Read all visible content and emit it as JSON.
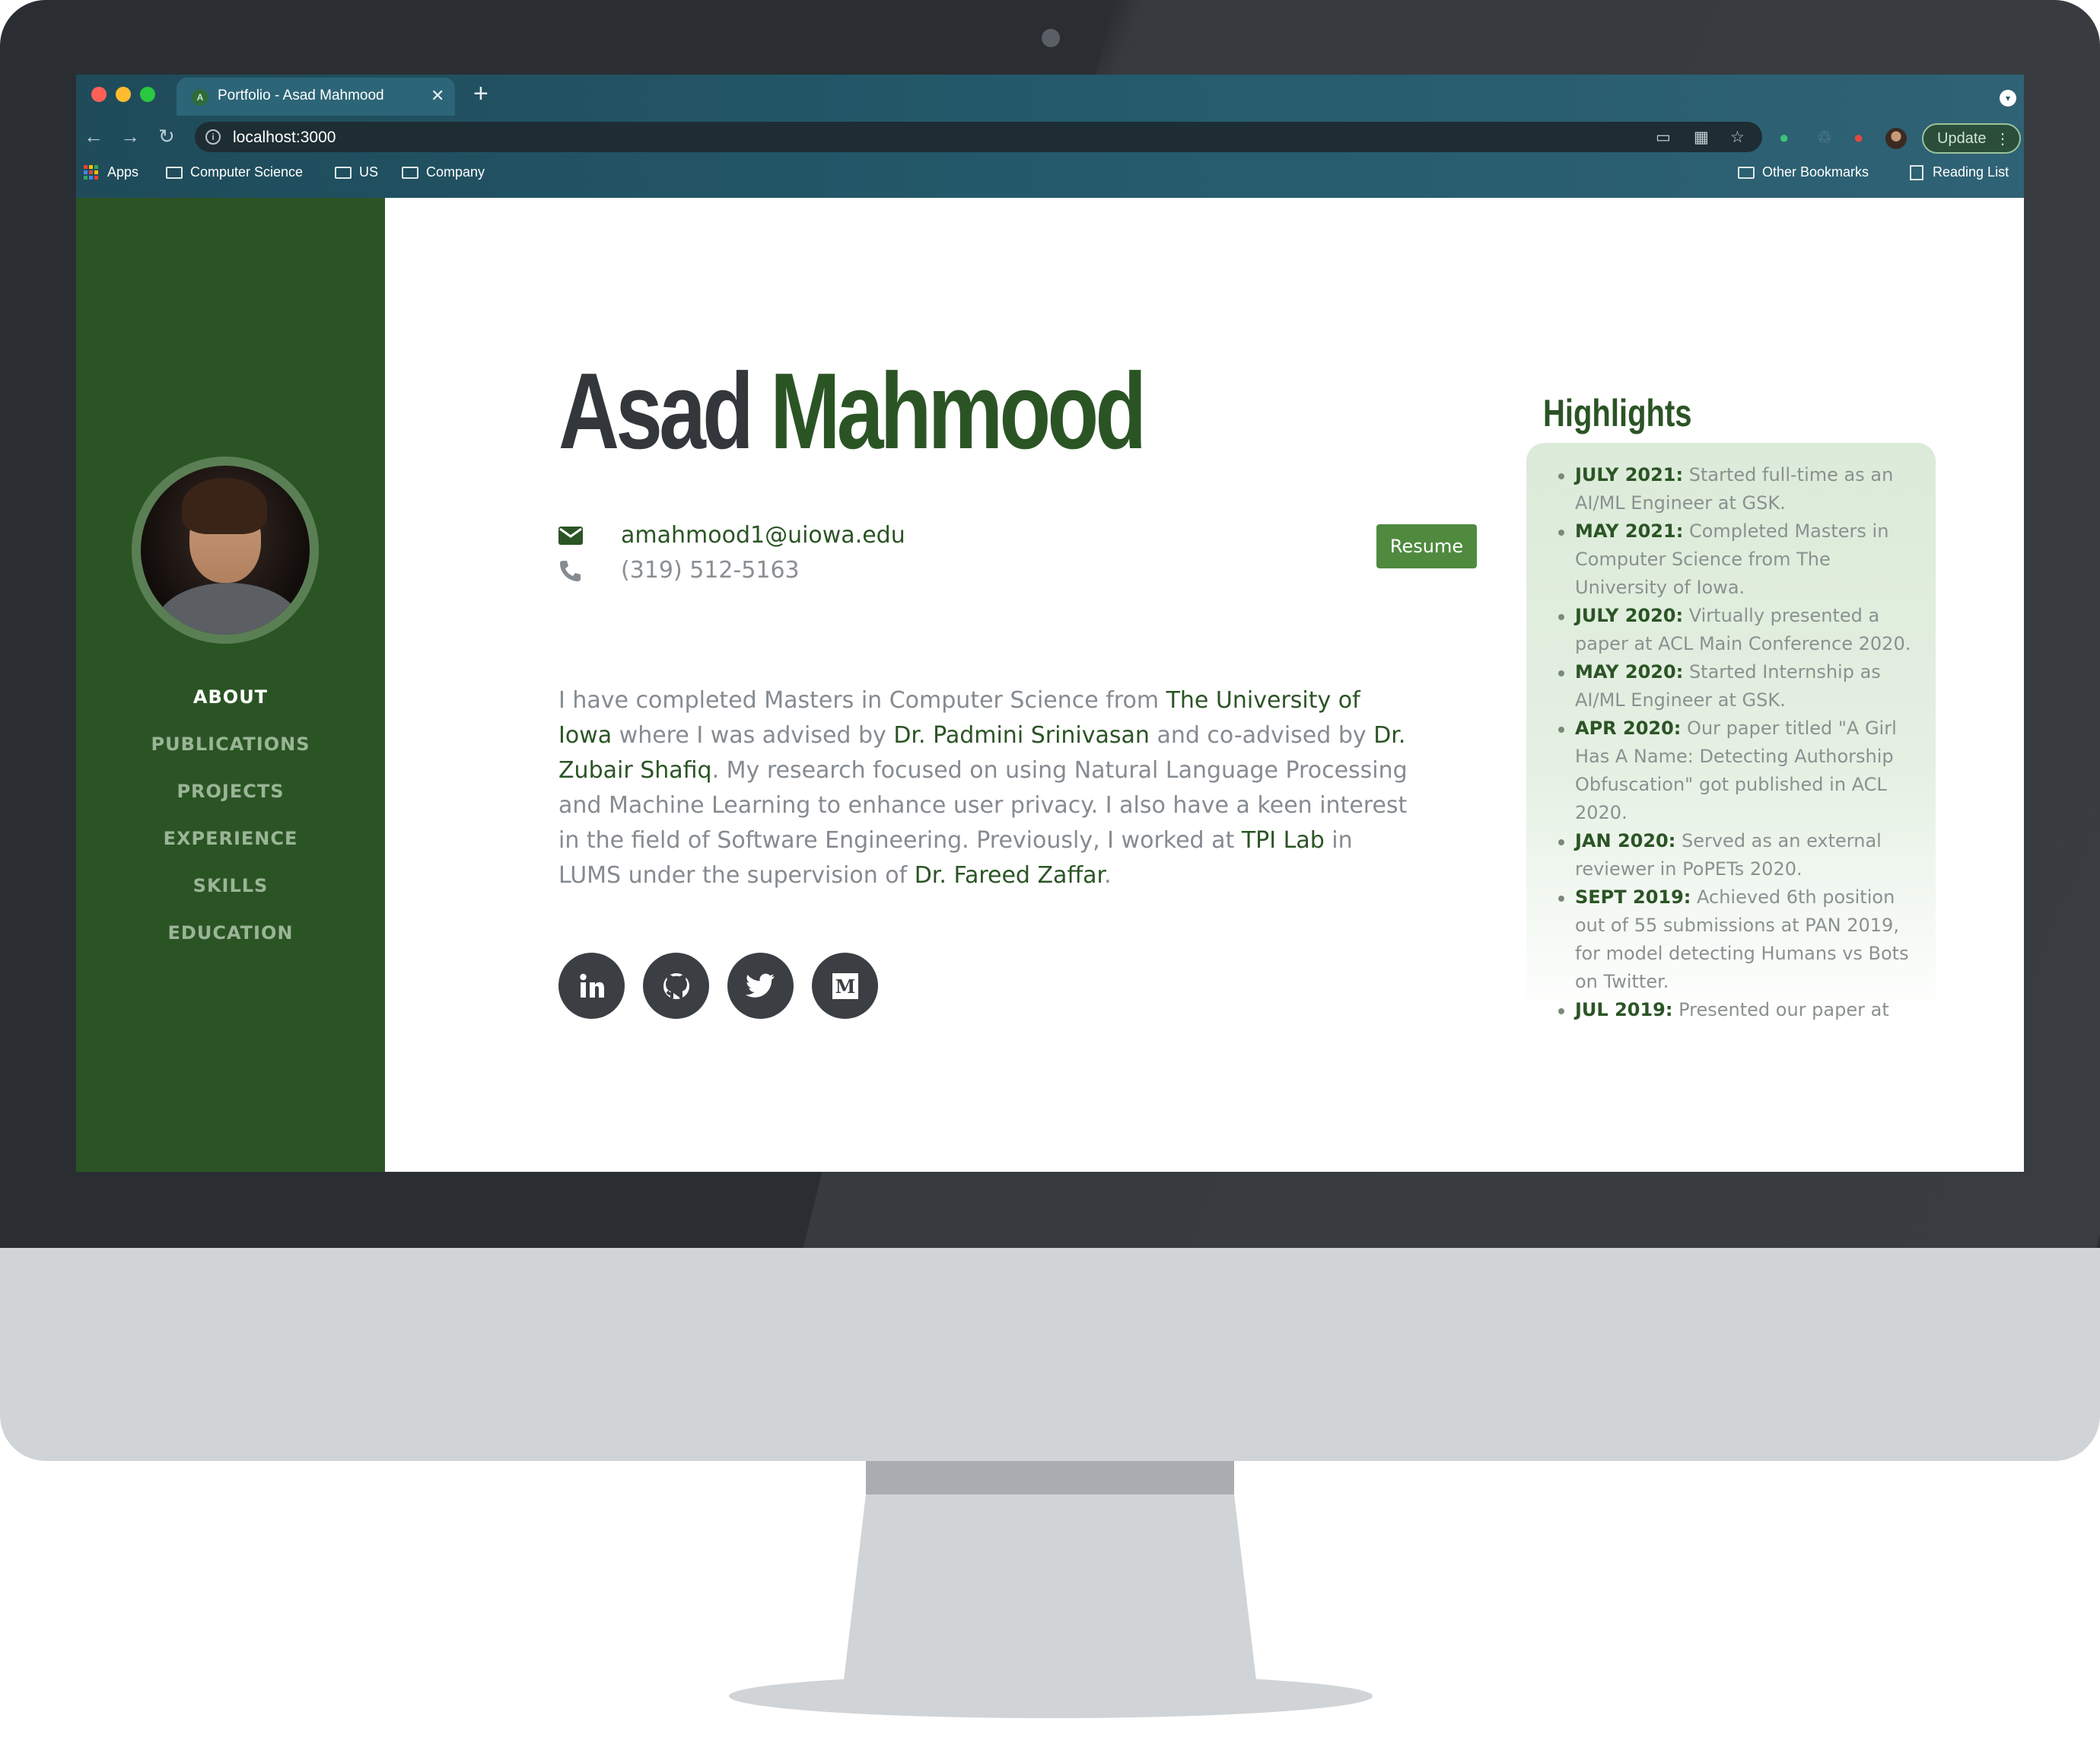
{
  "browser": {
    "tab_title": "Portfolio - Asad Mahmood",
    "tab_favicon": "A",
    "url": "localhost:3000",
    "update_label": "Update",
    "bookmarks": [
      "Apps",
      "Computer Science",
      "US",
      "Company"
    ],
    "other_bookmarks": "Other Bookmarks",
    "reading_list": "Reading List"
  },
  "sidebar": {
    "nav": [
      "ABOUT",
      "PUBLICATIONS",
      "PROJECTS",
      "EXPERIENCE",
      "SKILLS",
      "EDUCATION"
    ],
    "active": "ABOUT"
  },
  "profile": {
    "first_name": "Asad",
    "last_name": "Mahmood",
    "email": "amahmood1@uiowa.edu",
    "phone": "(319) 512-5163",
    "resume_label": "Resume"
  },
  "about": {
    "t1": "I have completed Masters in Computer Science from ",
    "l1": "The University of Iowa",
    "t2": " where I was advised by ",
    "l2": "Dr. Padmini Srinivasan",
    "t3": " and co-advised by ",
    "l3": "Dr. Zubair Shafiq",
    "t4": ". My research focused on using Natural Language Processing and Machine Learning to enhance user privacy. I also have a keen interest in the field of Software Engineering. Previously, I worked at ",
    "l4": "TPI Lab",
    "t5": " in LUMS under the supervision of ",
    "l5": "Dr. Fareed Zaffar",
    "t6": "."
  },
  "social": [
    "linkedin-icon",
    "github-icon",
    "twitter-icon",
    "medium-icon"
  ],
  "highlights": {
    "title": "Highlights",
    "items": [
      {
        "date": "JULY 2021:",
        "text": "Started full-time as an AI/ML Engineer at GSK."
      },
      {
        "date": "MAY 2021:",
        "text": "Completed Masters in Computer Science from The University of Iowa."
      },
      {
        "date": "JULY 2020:",
        "text": "Virtually presented a paper at ACL Main Conference 2020."
      },
      {
        "date": "MAY 2020:",
        "text": "Started Internship as AI/ML Engineer at GSK."
      },
      {
        "date": "APR 2020:",
        "text": "Our paper titled \"A Girl Has A Name: Detecting Authorship Obfuscation\" got published in ACL 2020."
      },
      {
        "date": "JAN 2020:",
        "text": "Served as an external reviewer in PoPETs 2020."
      },
      {
        "date": "SEPT 2019:",
        "text": "Achieved 6th position out of 55 submissions at PAN 2019, for model detecting Humans vs Bots on Twitter."
      },
      {
        "date": "JUL 2019:",
        "text": "Presented our paper at"
      }
    ]
  },
  "colors": {
    "sidebar": "#2b5425",
    "accent": "#2b5425",
    "resume_button": "#4f8a3f",
    "text_muted": "#858b90"
  }
}
